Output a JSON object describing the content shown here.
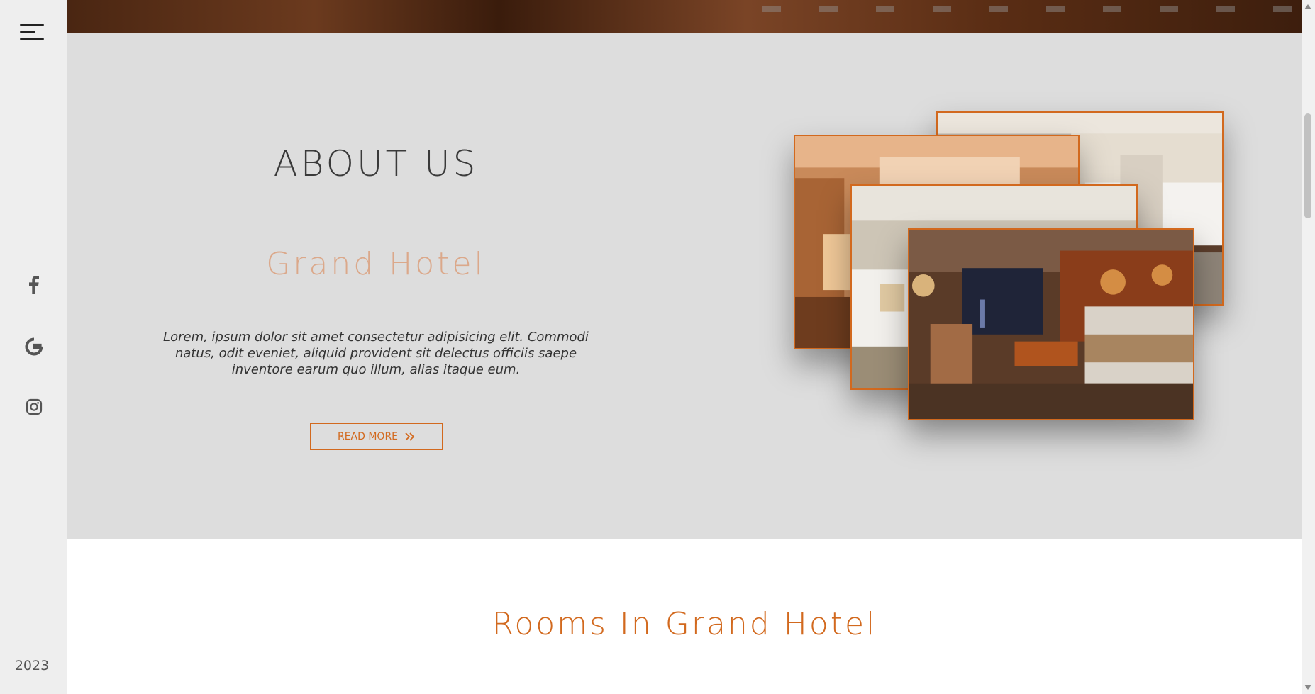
{
  "sidebar": {
    "menu_icon": "hamburger-menu-icon",
    "social": [
      {
        "name": "facebook",
        "icon": "facebook-icon"
      },
      {
        "name": "google",
        "icon": "google-icon"
      },
      {
        "name": "instagram",
        "icon": "instagram-icon"
      }
    ],
    "year": "2023"
  },
  "about": {
    "title": "ABOUT US",
    "subtitle": "Grand Hotel",
    "description": "Lorem, ipsum dolor sit amet consectetur adipisicing elit. Commodi natus, odit eveniet, aliquid provident sit delectus officiis saepe inventore earum quo illum, alias itaque eum.",
    "button_label": "READ MORE",
    "button_icon": "double-chevron-right-icon"
  },
  "rooms": {
    "title": "Rooms In Grand Hotel"
  },
  "colors": {
    "accent": "#d2691e",
    "subtitle": "#dba88a",
    "sidebar_bg": "#eeeeee",
    "about_bg": "#dddddd"
  }
}
